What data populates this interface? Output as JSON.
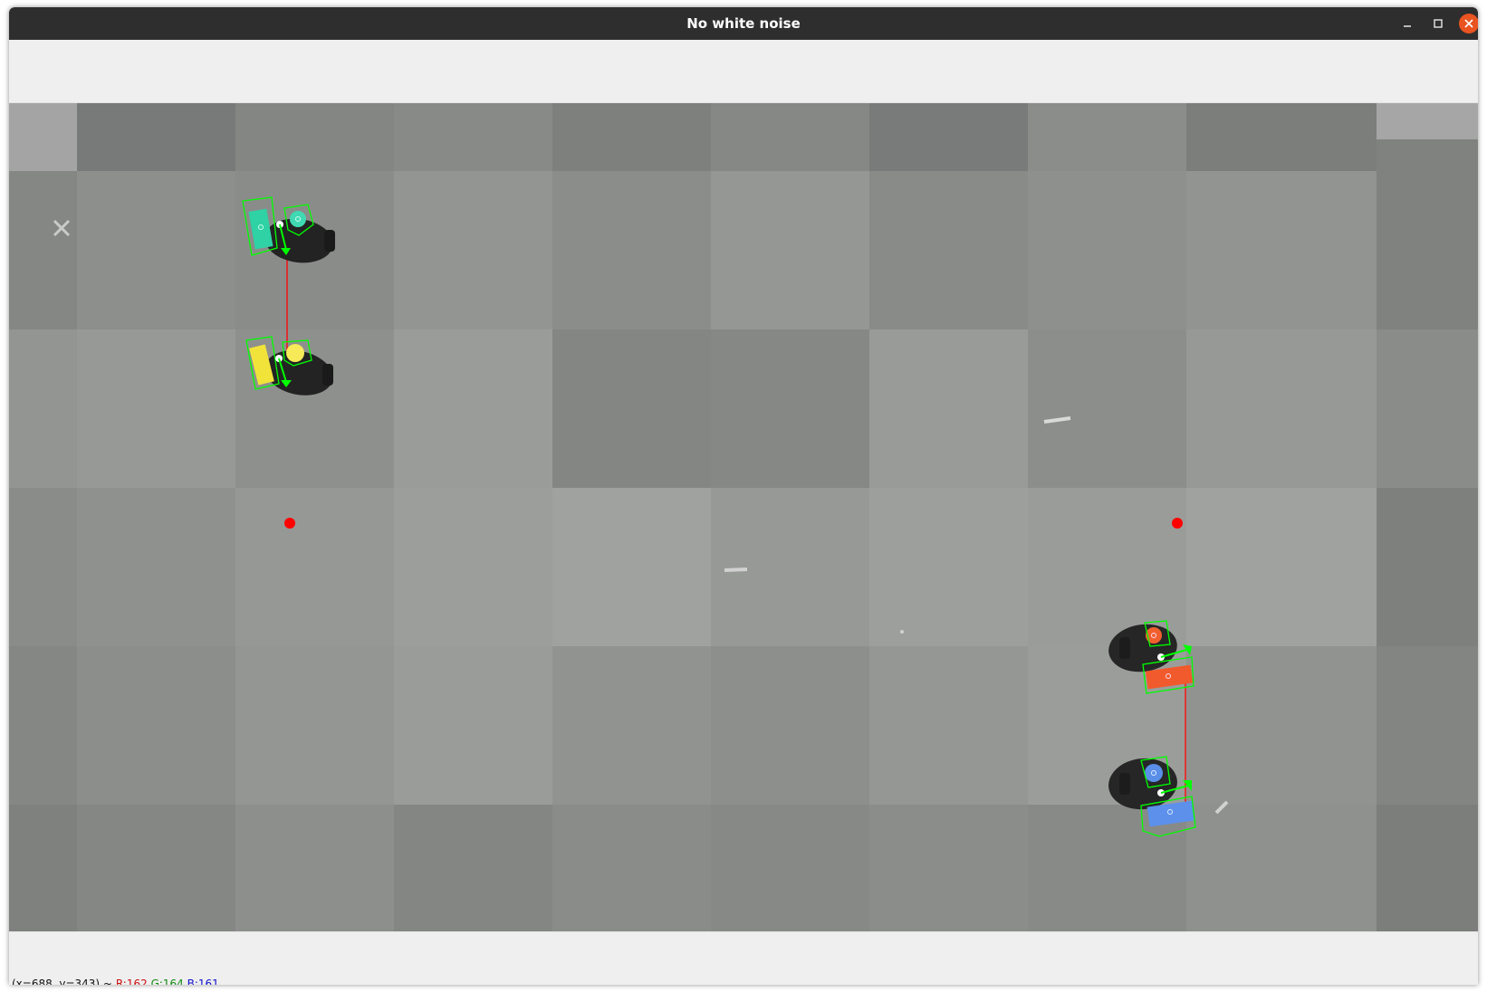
{
  "window": {
    "title": "No white noise",
    "controls": {
      "minimize_icon": "minimize-icon",
      "maximize_icon": "maximize-icon",
      "close_icon": "close-icon",
      "close_color": "#e95420"
    }
  },
  "status": {
    "coords": "(x=688, y=343) ~",
    "r": "R:162",
    "g": "G:164",
    "b": "B:161"
  },
  "scene": {
    "description_colors": {
      "detection": "#00ff00",
      "link_line": "#ff0000",
      "target": "#ff0000",
      "robot_body": "#1e1e1e"
    },
    "robots": [
      {
        "name": "teal",
        "color": "#2ed3a3"
      },
      {
        "name": "yellow",
        "color": "#f2e33a"
      },
      {
        "name": "orange",
        "color": "#f0582a"
      },
      {
        "name": "blue",
        "color": "#5a8fe8"
      }
    ],
    "targets": 2
  }
}
